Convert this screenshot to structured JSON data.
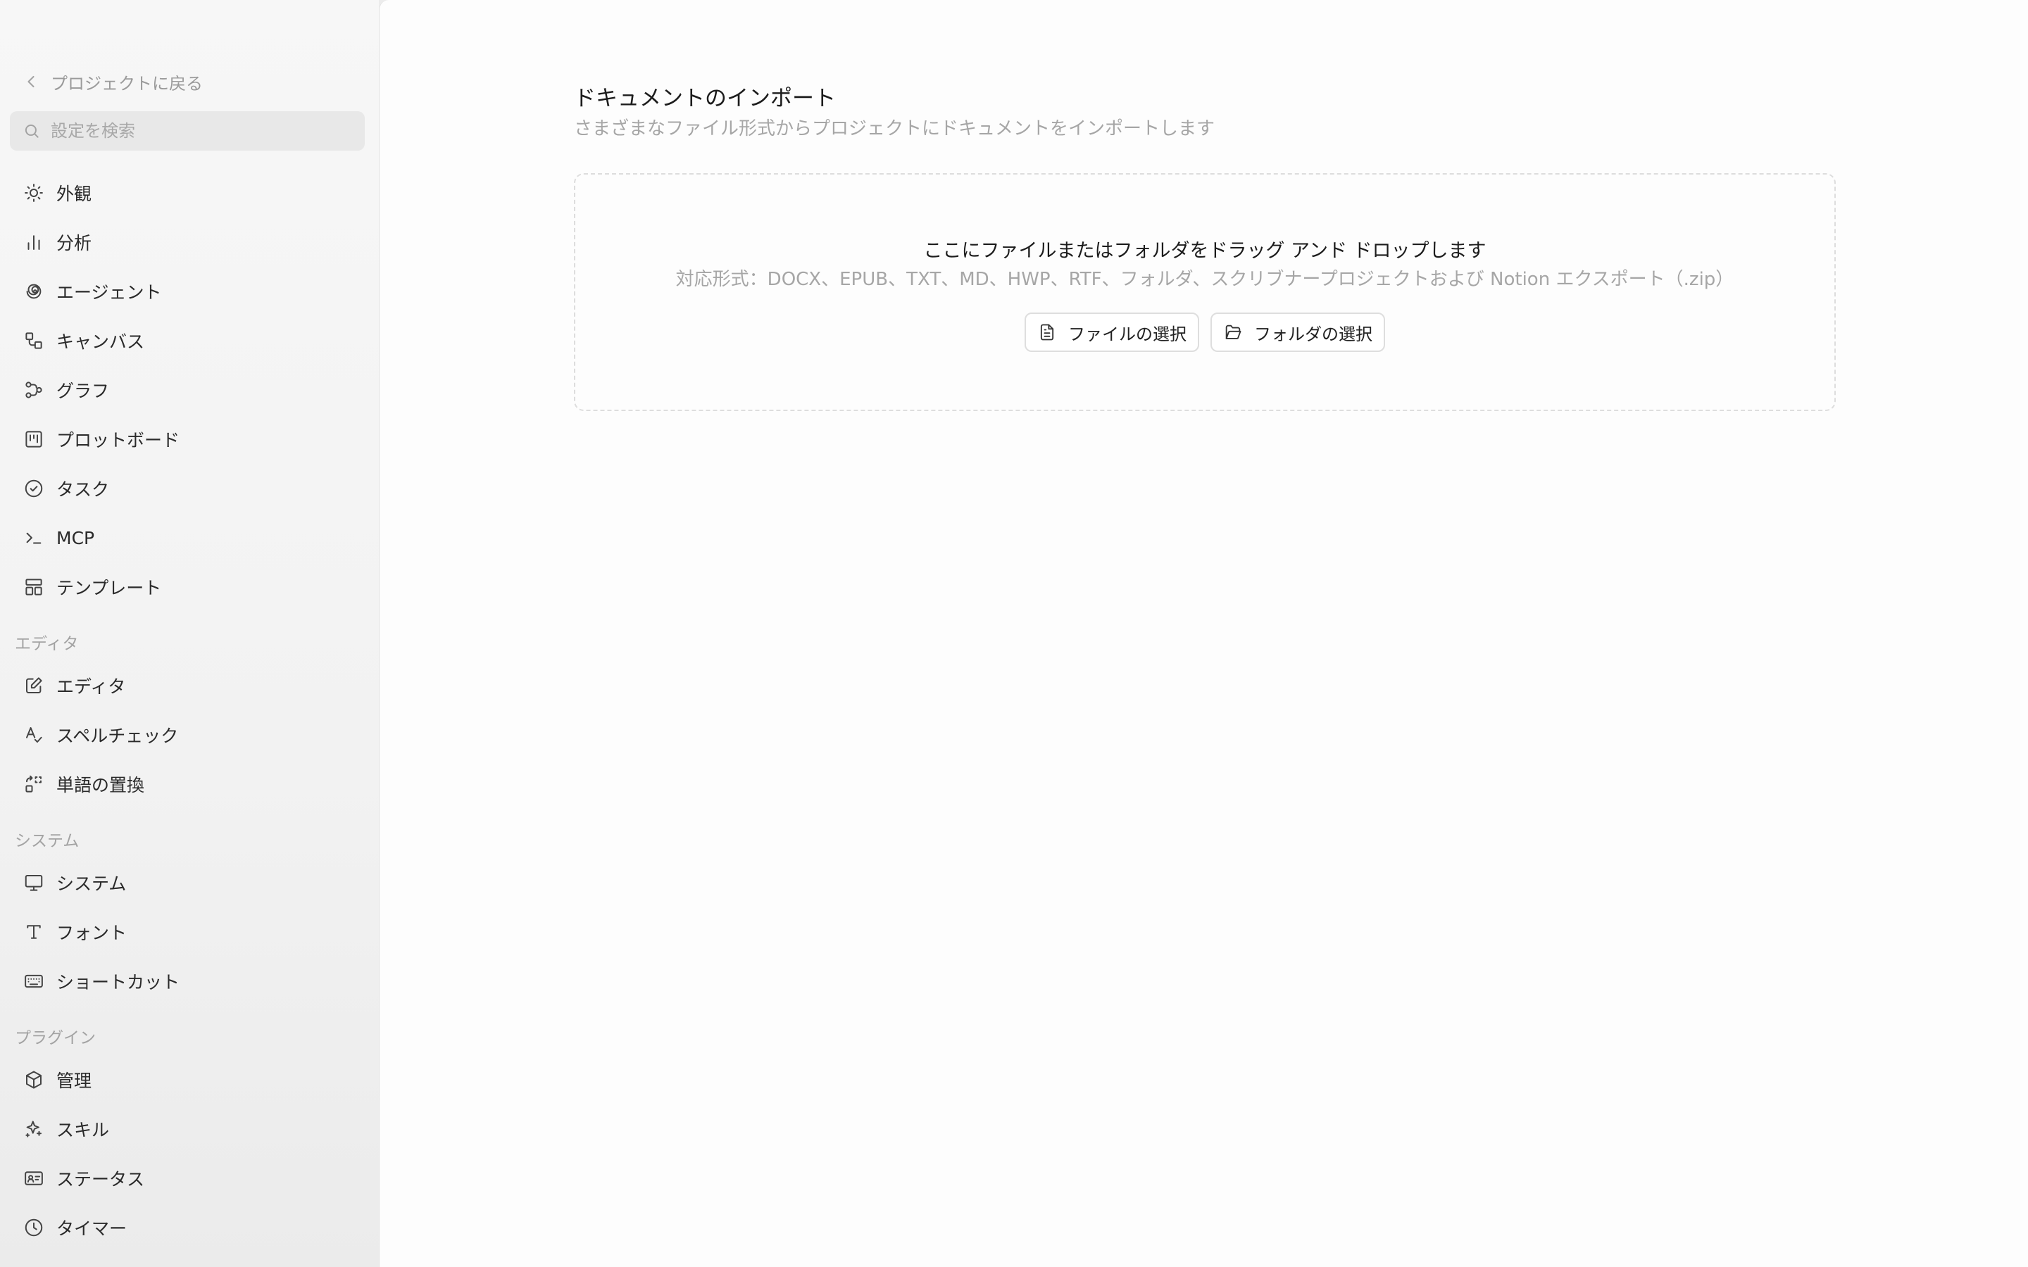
{
  "sidebar": {
    "back_label": "プロジェクトに戻る",
    "search_placeholder": "設定を検索",
    "general_items": [
      {
        "label": "外観",
        "icon": "sun-icon"
      },
      {
        "label": "分析",
        "icon": "bar-chart-icon"
      },
      {
        "label": "エージェント",
        "icon": "spiral-icon"
      },
      {
        "label": "キャンバス",
        "icon": "shapes-icon"
      },
      {
        "label": "グラフ",
        "icon": "workflow-icon"
      },
      {
        "label": "プロットボード",
        "icon": "kanban-icon"
      },
      {
        "label": "タスク",
        "icon": "check-circle-icon"
      },
      {
        "label": "MCP",
        "icon": "terminal-icon"
      },
      {
        "label": "テンプレート",
        "icon": "layout-template-icon"
      }
    ],
    "sections": {
      "editor": {
        "header": "エディタ",
        "items": [
          {
            "label": "エディタ",
            "icon": "edit-icon"
          },
          {
            "label": "スペルチェック",
            "icon": "spell-check-icon"
          },
          {
            "label": "単語の置換",
            "icon": "replace-icon"
          }
        ]
      },
      "system": {
        "header": "システム",
        "items": [
          {
            "label": "システム",
            "icon": "monitor-icon"
          },
          {
            "label": "フォント",
            "icon": "type-icon"
          },
          {
            "label": "ショートカット",
            "icon": "keyboard-icon"
          }
        ]
      },
      "plugins": {
        "header": "プラグイン",
        "items": [
          {
            "label": "管理",
            "icon": "package-icon"
          },
          {
            "label": "スキル",
            "icon": "sparkles-icon"
          },
          {
            "label": "ステータス",
            "icon": "id-card-icon"
          },
          {
            "label": "タイマー",
            "icon": "clock-icon"
          }
        ]
      }
    }
  },
  "main": {
    "title": "ドキュメントのインポート",
    "subtitle": "さまざまなファイル形式からプロジェクトにドキュメントをインポートします",
    "dropzone": {
      "title": "ここにファイルまたはフォルダをドラッグ アンド ドロップします",
      "formats": "対応形式：DOCX、EPUB、TXT、MD、HWP、RTF、フォルダ、スクリブナープロジェクトおよび Notion エクスポート（.zip）",
      "select_file_label": "ファイルの選択",
      "select_folder_label": "フォルダの選択"
    }
  },
  "colors": {
    "sidebar_bg": "#f4f4f4",
    "main_bg": "#fdfdfd",
    "muted_text": "#a6a6a6",
    "primary_text": "#1c1c1c",
    "border": "#dddddd"
  }
}
